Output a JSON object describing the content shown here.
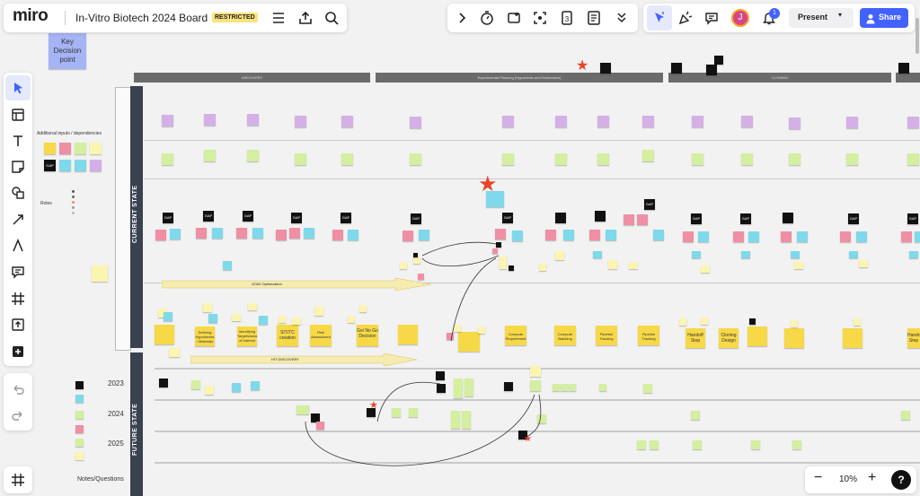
{
  "app": {
    "logo": "miro",
    "board_title": "In-Vitro Biotech 2024 Board",
    "badge": "RESTRICTED"
  },
  "toolbar_right": {
    "present_label": "Present",
    "share_label": "Share",
    "avatar_initial": "J",
    "notif_count": "1"
  },
  "canvas": {
    "key_decision_label": "Key Decision point",
    "phases": [
      "DISCOVERY",
      "Experimental Planning (Hypothesis and Nomination)",
      "CLONING"
    ],
    "section_current": "CURRENT STATE",
    "section_future": "FUTURE STATE",
    "legend_additional": "Additional inputs / dependencies",
    "legend_roles": "Roles",
    "years": [
      "2023",
      "2024",
      "2025"
    ],
    "notes_questions": "Notes/Questions",
    "gap_label": "GAP",
    "process_notes": [
      "Defining Hypotheses / Materials",
      "Identifying Targets/area of Interest",
      "SIT/TC creation",
      "Risk Assessment",
      "Go/ No Go Decision",
      "Compute Requirement",
      "Compute Batching",
      "Pipeline Tracking",
      "Handoff Step",
      "Cloning Design",
      "Handoff Step"
    ],
    "arrow_labels": [
      "LEAD Optimization",
      "HIT DISCOVERY"
    ]
  },
  "bottom_bar": {
    "zoom_level": "10%",
    "zoom_out": "−",
    "zoom_in": "+",
    "help": "?"
  },
  "colors": {
    "share_blue": "#4262ff",
    "accent_blue": "#4262ff",
    "badge_yellow": "#fce37c",
    "star_red": "#e8462b",
    "header_dark": "#3a4250",
    "phase_bar": "#6b6b6b"
  },
  "icons": {
    "left_tools": [
      "select-icon",
      "frame-template-icon",
      "text-icon",
      "sticky-note-icon",
      "shapes-icon",
      "arrow-line-icon",
      "pen-icon",
      "comment-icon",
      "frame-icon",
      "upload-icon",
      "more-tools-icon",
      "undo-icon",
      "redo-icon"
    ],
    "top_center": [
      "chevron-right-icon",
      "timer-icon",
      "screen-share-icon",
      "focus-icon",
      "vote-icon",
      "notes-icon",
      "chevron-double-down-icon"
    ]
  }
}
